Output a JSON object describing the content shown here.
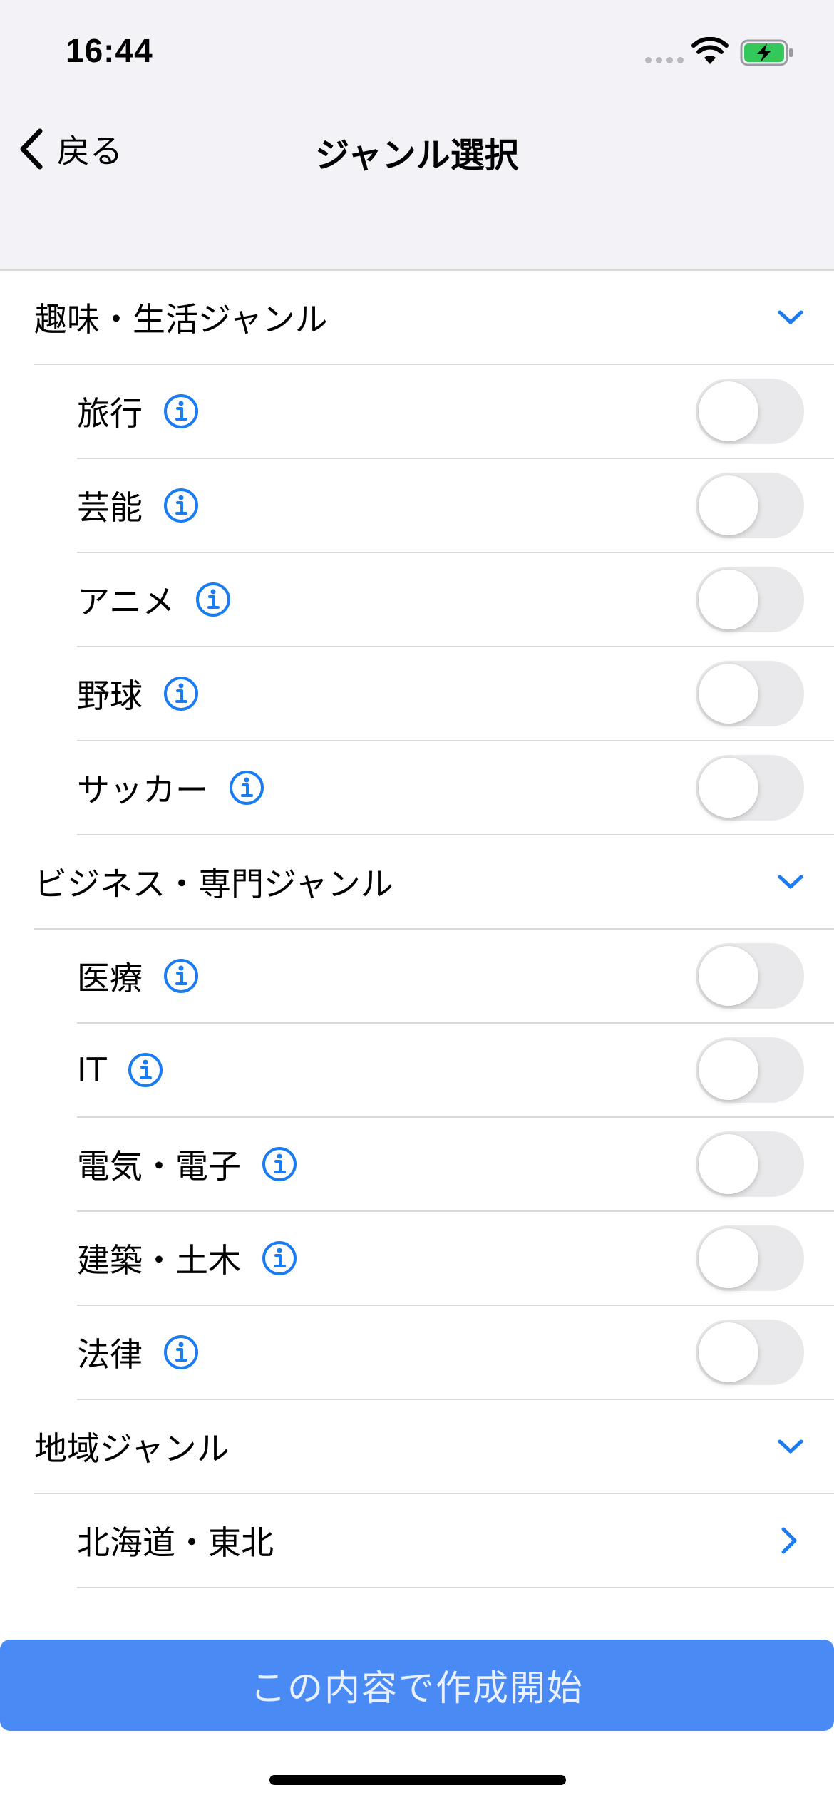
{
  "status_bar": {
    "time": "16:44",
    "icons": [
      "signal-icon",
      "wifi-icon",
      "battery-charging-icon"
    ],
    "battery_color": "#34c759"
  },
  "nav": {
    "back_label": "戻る",
    "title": "ジャンル選択"
  },
  "accent_color": "#1a7cf0",
  "sections": [
    {
      "title": "趣味・生活ジャンル",
      "items": [
        {
          "label": "旅行",
          "on": false
        },
        {
          "label": "芸能",
          "on": false
        },
        {
          "label": "アニメ",
          "on": false
        },
        {
          "label": "野球",
          "on": false
        },
        {
          "label": "サッカー",
          "on": false
        }
      ]
    },
    {
      "title": "ビジネス・専門ジャンル",
      "items": [
        {
          "label": "医療",
          "on": false
        },
        {
          "label": "IT",
          "on": false
        },
        {
          "label": "電気・電子",
          "on": false
        },
        {
          "label": "建築・土木",
          "on": false
        },
        {
          "label": "法律",
          "on": false
        }
      ]
    },
    {
      "title": "地域ジャンル",
      "items": [
        {
          "label": "北海道・東北"
        }
      ]
    }
  ],
  "create_button_label": "この内容で作成開始"
}
